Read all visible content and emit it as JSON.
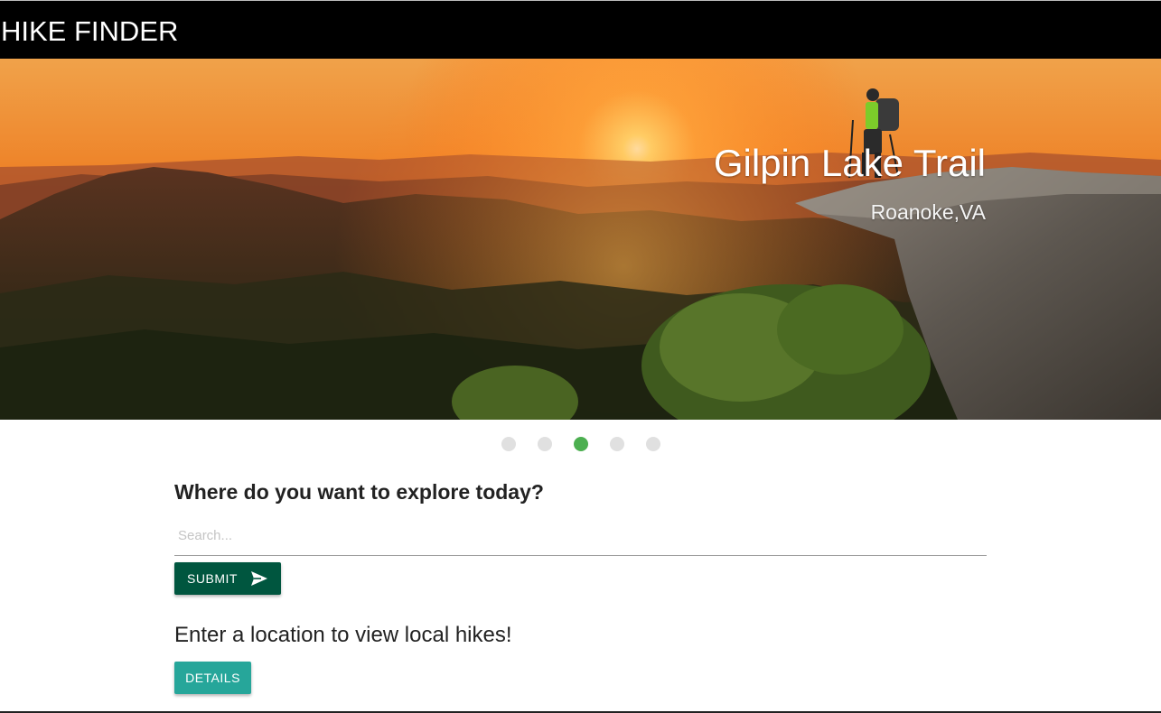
{
  "navbar": {
    "brand": "HIKE FINDER"
  },
  "carousel": {
    "slide_title": "Gilpin Lake Trail",
    "slide_location": "Roanoke,VA",
    "indicator_count": 5,
    "active_index": 2,
    "active_color": "#4caf50",
    "inactive_color": "#e0e0e0"
  },
  "search": {
    "heading": "Where do you want to explore today?",
    "placeholder": "Search...",
    "value": "",
    "submit_label": "SUBMIT",
    "submit_color": "#00563f"
  },
  "results": {
    "message": "Enter a location to view local hikes!",
    "details_label": "DETAILS",
    "details_color": "#26a69a"
  },
  "icons": {
    "submit": "send-icon"
  }
}
